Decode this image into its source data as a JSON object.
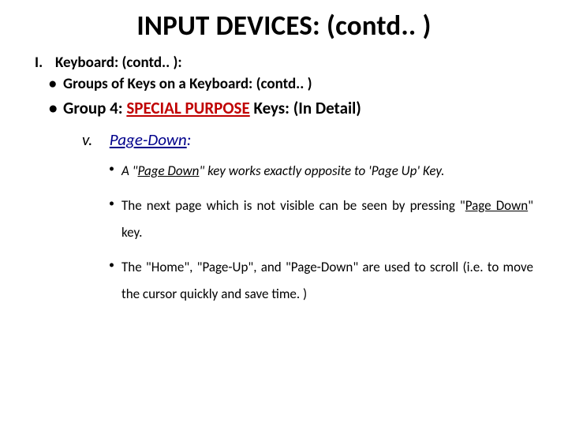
{
  "title": "INPUT DEVICES: (contd.. )",
  "line1": {
    "roman": "I.",
    "text": "Keyboard: (contd.. ):"
  },
  "line2": {
    "bullet": "•",
    "text": "Groups of Keys on a Keyboard: (contd.. )"
  },
  "group4": {
    "bullet": "•",
    "prefix": "Group 4:   ",
    "red": "SPECIAL PURPOSE",
    "suffix": " Keys: (In Detail)"
  },
  "sub": {
    "roman": "v.",
    "head": "Page-Down",
    "colon": ":"
  },
  "points": [
    {
      "pre": "A \"",
      "u": "Page Down",
      "mid": "\" key works exactly opposite to 'Page Up' Key."
    },
    {
      "pre": "The next page which is not visible can be seen by pressing \"",
      "u": "Page Down",
      "mid": "\" key."
    },
    {
      "pre": "The \"Home\", \"Page-Up\", and \"Page-Down\" are used to scroll (i.e. to move the cursor quickly and save time. )",
      "u": "",
      "mid": ""
    }
  ]
}
